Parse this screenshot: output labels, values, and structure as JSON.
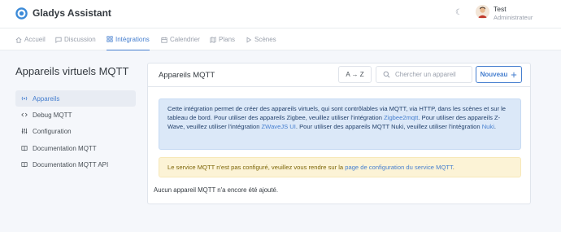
{
  "header": {
    "app_title": "Gladys Assistant",
    "user_name": "Test",
    "user_role": "Administrateur"
  },
  "nav": {
    "tabs": [
      {
        "label": "Accueil",
        "icon": "home-icon"
      },
      {
        "label": "Discussion",
        "icon": "message-icon"
      },
      {
        "label": "Intégrations",
        "icon": "grid-icon",
        "active": true
      },
      {
        "label": "Calendrier",
        "icon": "calendar-icon"
      },
      {
        "label": "Plans",
        "icon": "map-icon"
      },
      {
        "label": "Scènes",
        "icon": "play-icon"
      }
    ]
  },
  "sidebar": {
    "title": "Appareils virtuels MQTT",
    "items": [
      {
        "label": "Appareils",
        "icon": "radio-icon",
        "active": true
      },
      {
        "label": "Debug MQTT",
        "icon": "code-icon"
      },
      {
        "label": "Configuration",
        "icon": "sliders-icon"
      },
      {
        "label": "Documentation MQTT",
        "icon": "book-icon"
      },
      {
        "label": "Documentation MQTT API",
        "icon": "book-icon"
      }
    ]
  },
  "main": {
    "card_title": "Appareils MQTT",
    "sort_label": "A → Z",
    "search_placeholder": "Chercher un appareil",
    "new_button": "Nouveau",
    "info": {
      "t1": "Cette intégration permet de créer des appareils virtuels, qui sont contrôlables via MQTT, via HTTP, dans les scènes et sur le tableau de bord. Pour utiliser des appareils Zigbee, veuillez utiliser l'intégration ",
      "l1": "Zigbee2mqtt",
      "t2": ". Pour utiliser des appareils Z-Wave, veuillez utiliser l'intégration ",
      "l2": "ZWaveJS UI",
      "t3": ". Pour utiliser des appareils MQTT Nuki, veuillez utiliser l'intégration ",
      "l3": "Nuki",
      "t4": "."
    },
    "warning": {
      "t1": "Le service MQTT n'est pas configuré, veuillez vous rendre sur la ",
      "link": "page de configuration du service MQTT",
      "t2": "."
    },
    "empty_text": "Aucun appareil MQTT n'a encore été ajouté."
  },
  "colors": {
    "accent": "#467fcf",
    "info_bg": "#dbe8f8",
    "warning_bg": "#fcf3d6"
  }
}
